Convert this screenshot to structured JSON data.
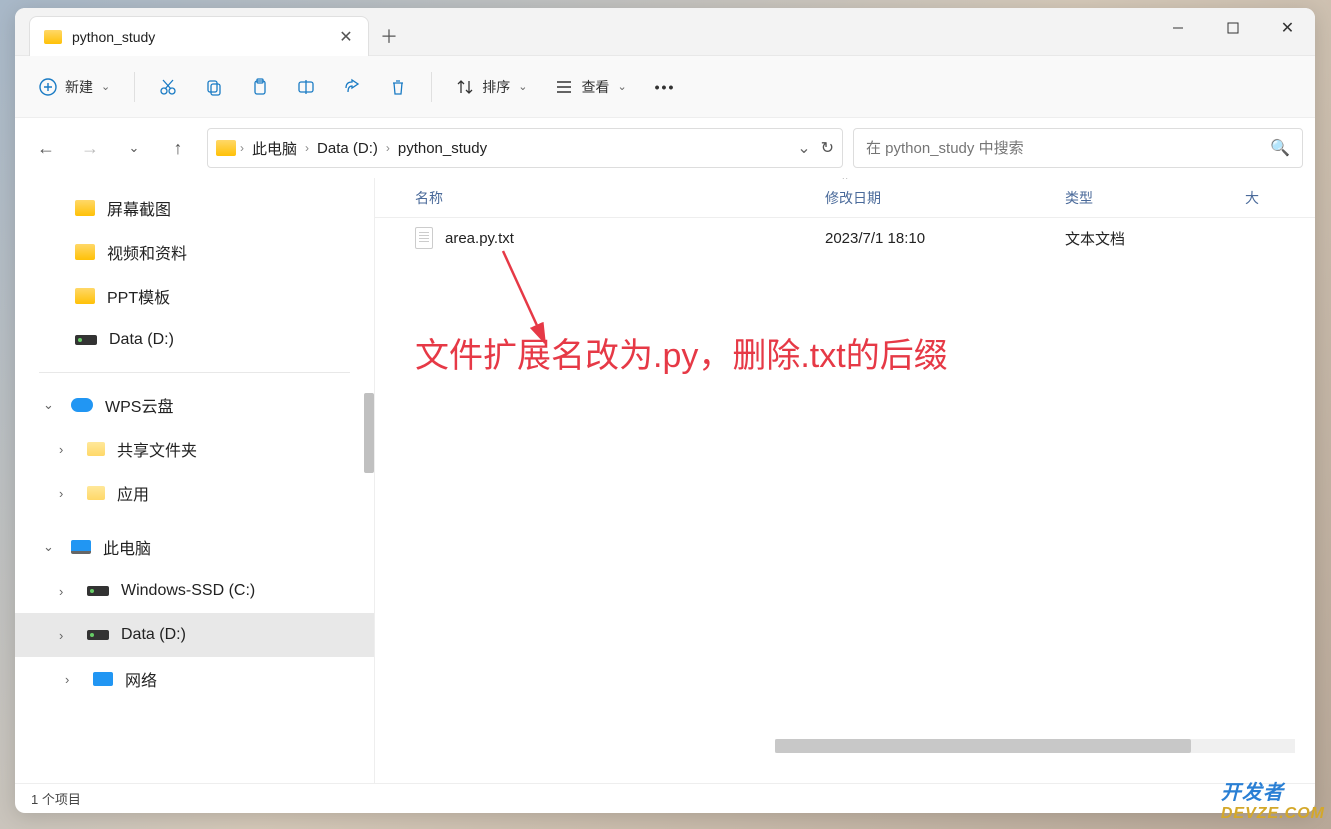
{
  "tab": {
    "title": "python_study"
  },
  "toolbar": {
    "new_label": "新建",
    "sort_label": "排序",
    "view_label": "查看"
  },
  "breadcrumb": {
    "item1": "此电脑",
    "item2": "Data (D:)",
    "item3": "python_study"
  },
  "search": {
    "placeholder": "在 python_study 中搜索"
  },
  "sidebar": {
    "quick1": "屏幕截图",
    "quick2": "视频和资料",
    "quick3": "PPT模板",
    "quick4": "Data (D:)",
    "wps": "WPS云盘",
    "wps_shared": "共享文件夹",
    "wps_app": "应用",
    "thispc": "此电脑",
    "drive_c": "Windows-SSD (C:)",
    "drive_d": "Data (D:)",
    "network": "网络"
  },
  "columns": {
    "name": "名称",
    "date": "修改日期",
    "type": "类型",
    "size": "大"
  },
  "files": [
    {
      "name": "area.py.txt",
      "date": "2023/7/1 18:10",
      "type": "文本文档"
    }
  ],
  "annotation": "文件扩展名改为.py，删除.txt的后缀",
  "status": "1 个项目",
  "watermark": {
    "line1": "开发者",
    "line2": "DEVZE.COM"
  }
}
